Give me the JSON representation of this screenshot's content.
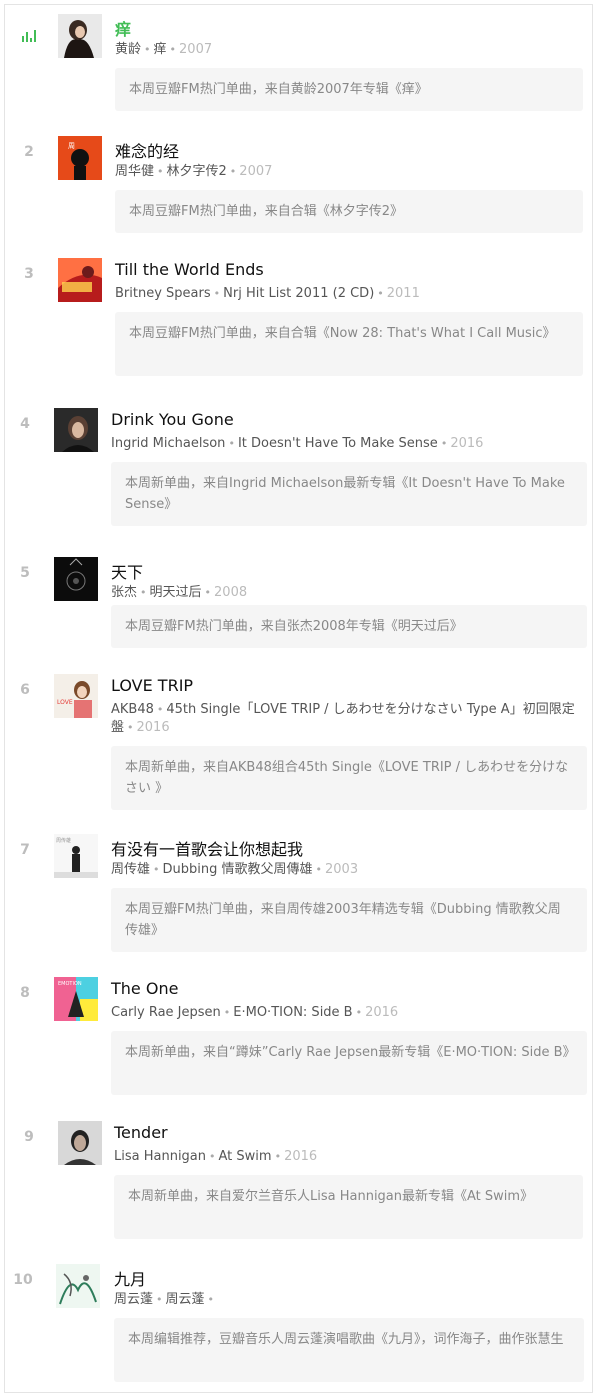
{
  "items": [
    {
      "rank": "",
      "title": "痒",
      "artist": "黄龄",
      "album": "痒",
      "year": "2007",
      "note": "本周豆瓣FM热门单曲，来自黄龄2007年专辑《痒》",
      "active": true
    },
    {
      "rank": "2",
      "title": "难念的经",
      "artist": "周华健",
      "album": "林夕字传2",
      "year": "2007",
      "note": "本周豆瓣FM热门单曲，来自合辑《林夕字传2》"
    },
    {
      "rank": "3",
      "title": "Till the World Ends",
      "artist": "Britney Spears",
      "album": "Nrj Hit List 2011 (2 CD)",
      "year": "2011",
      "note": "本周豆瓣FM热门单曲，来自合辑《Now 28: That's What I Call Music》"
    },
    {
      "rank": "4",
      "title": "Drink You Gone",
      "artist": "Ingrid Michaelson",
      "album": "It Doesn't Have To Make Sense",
      "year": "2016",
      "note": "本周新单曲，来自Ingrid Michaelson最新专辑《It Doesn't Have To Make Sense》"
    },
    {
      "rank": "5",
      "title": "天下",
      "artist": "张杰",
      "album": "明天过后",
      "year": "2008",
      "note": "本周豆瓣FM热门单曲，来自张杰2008年专辑《明天过后》"
    },
    {
      "rank": "6",
      "title": "LOVE TRIP",
      "artist": "AKB48",
      "album": "45th Single「LOVE TRIP / しあわせを分けなさい Type A」初回限定盤",
      "year": "2016",
      "note": "本周新单曲，来自AKB48组合45th Single《LOVE TRIP / しあわせを分けなさい 》"
    },
    {
      "rank": "7",
      "title": "有没有一首歌会让你想起我",
      "artist": "周传雄",
      "album": "Dubbing 情歌教父周傳雄",
      "year": "2003",
      "note": "本周豆瓣FM热门单曲，来自周传雄2003年精选专辑《Dubbing 情歌教父周传雄》"
    },
    {
      "rank": "8",
      "title": "The One",
      "artist": "Carly Rae Jepsen",
      "album": "E·MO·TION: Side B",
      "year": "2016",
      "note": "本周新单曲，来自“蹲妹”Carly Rae Jepsen最新专辑《E·MO·TION: Side B》"
    },
    {
      "rank": "9",
      "title": "Tender",
      "artist": "Lisa Hannigan",
      "album": "At Swim",
      "year": "2016",
      "note": "本周新单曲，来自爱尔兰音乐人Lisa Hannigan最新专辑《At Swim》"
    },
    {
      "rank": "10",
      "title": "九月",
      "artist": "周云蓬",
      "album": "周云蓬",
      "year": "",
      "note": "本周编辑推荐，豆瓣音乐人周云蓬演唱歌曲《九月》，词作海子，曲作张慧生"
    }
  ],
  "colors": {
    "accent": "#42bd56",
    "note_bg": "#f5f5f5"
  },
  "icons": {
    "now_playing": "equalizer-bars-icon",
    "cover": "album-cover-icon"
  }
}
